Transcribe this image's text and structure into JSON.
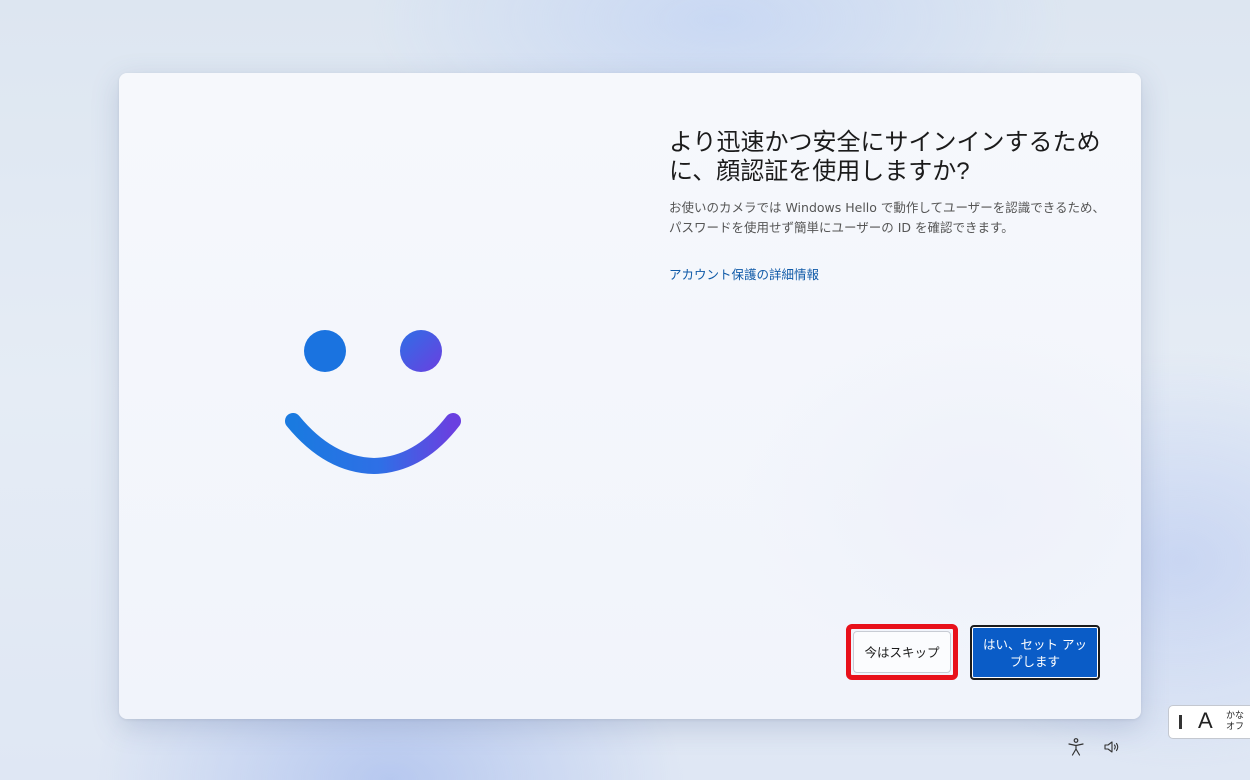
{
  "dialog": {
    "title": "より迅速かつ安全にサインインするために、顔認証を使用しますか?",
    "description": "お使いのカメラでは Windows Hello で動作してユーザーを認識できるため、パスワードを使用せず簡単にユーザーの ID を確認できます。",
    "link_label": "アカウント保護の詳細情報",
    "skip_button": "今はスキップ",
    "yes_button": "はい、セット アップします"
  },
  "ime": {
    "mode_letter": "A",
    "line1": "かな",
    "line2": "オフ"
  },
  "system_icons": [
    "accessibility-icon",
    "volume-icon"
  ],
  "colors": {
    "accent": "#0a5cc7",
    "link": "#0f5aa8",
    "highlight": "#e8101a",
    "smile_start": "#1a73e0",
    "smile_end": "#6a3fe0"
  }
}
